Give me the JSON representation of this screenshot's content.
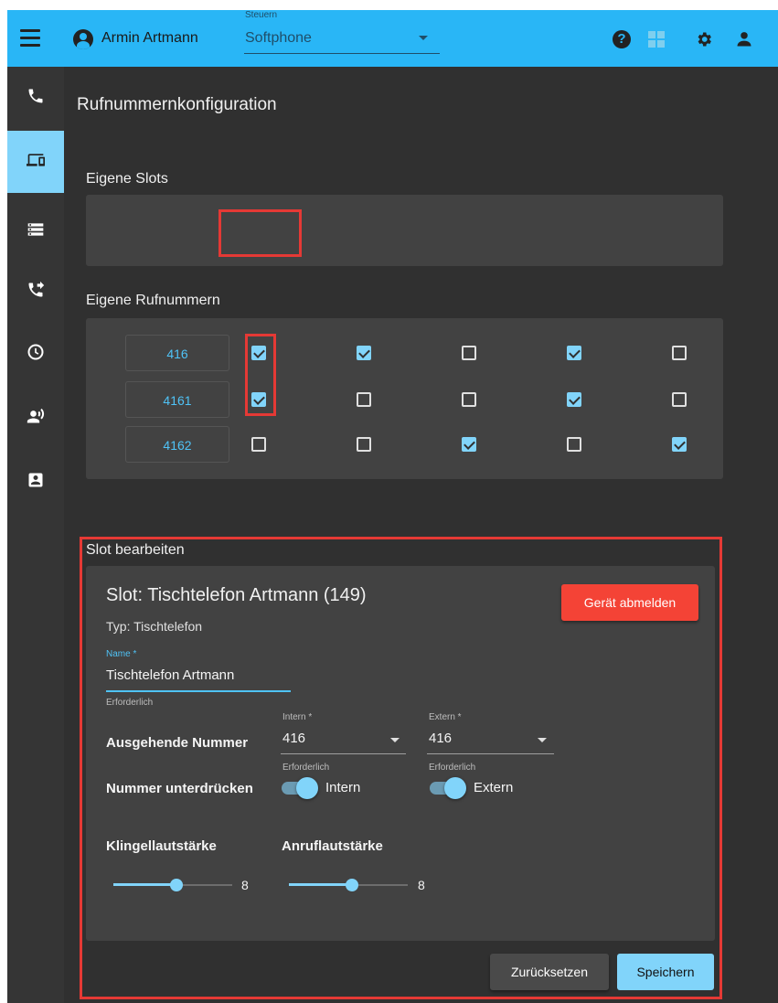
{
  "topbar": {
    "user_name": "Armin Artmann",
    "control_label": "Steuern",
    "control_value": "Softphone"
  },
  "page": {
    "title": "Rufnummernkonfiguration"
  },
  "slots": {
    "title": "Eigene Slots",
    "buttons": [
      {
        "icon": "phone-icon",
        "active": true
      },
      {
        "icon": "mobile-small-icon",
        "active": false
      },
      {
        "icon": "mobile-icon",
        "active": false
      },
      {
        "icon": "laptop-icon",
        "active": false
      },
      {
        "icon": "sip-phone-icon",
        "active": false
      }
    ]
  },
  "numbers": {
    "title": "Eigene Rufnummern",
    "rows": [
      {
        "number": "416",
        "checks": [
          true,
          true,
          false,
          true,
          false
        ]
      },
      {
        "number": "4161",
        "checks": [
          true,
          false,
          false,
          true,
          false
        ]
      },
      {
        "number": "4162",
        "checks": [
          false,
          false,
          true,
          false,
          true
        ]
      }
    ]
  },
  "edit": {
    "section_title": "Slot bearbeiten",
    "heading": "Slot: Tischtelefon Artmann (149)",
    "type": "Typ: Tischtelefon",
    "logout_label": "Gerät abmelden",
    "name_label": "Name *",
    "name_value": "Tischtelefon Artmann",
    "name_hint": "Erforderlich",
    "outgoing_label": "Ausgehende Nummer",
    "intern_label": "Intern *",
    "intern_value": "416",
    "intern_hint": "Erforderlich",
    "extern_label": "Extern *",
    "extern_value": "416",
    "extern_hint": "Erforderlich",
    "suppress_label": "Nummer unterdrücken",
    "toggle_intern_label": "Intern",
    "toggle_extern_label": "Extern",
    "toggle_intern_on": true,
    "toggle_extern_on": true,
    "ring_volume_label": "Klingellautstärke",
    "ring_volume_value": "8",
    "call_volume_label": "Anruflautstärke",
    "call_volume_value": "8",
    "reset_label": "Zurücksetzen",
    "save_label": "Speichern"
  },
  "colors": {
    "accent": "#29b6f6",
    "accent_light": "#81d4fa",
    "danger": "#f44336",
    "highlight_box": "#e53935"
  },
  "sidebar": {
    "items": [
      {
        "icon": "phone-icon",
        "active": false
      },
      {
        "icon": "devices-icon",
        "active": true
      },
      {
        "icon": "storage-icon",
        "active": false
      },
      {
        "icon": "call-forward-icon",
        "active": false
      },
      {
        "icon": "clock-icon",
        "active": false
      },
      {
        "icon": "record-voice-icon",
        "active": false
      },
      {
        "icon": "contact-icon",
        "active": false
      }
    ]
  }
}
